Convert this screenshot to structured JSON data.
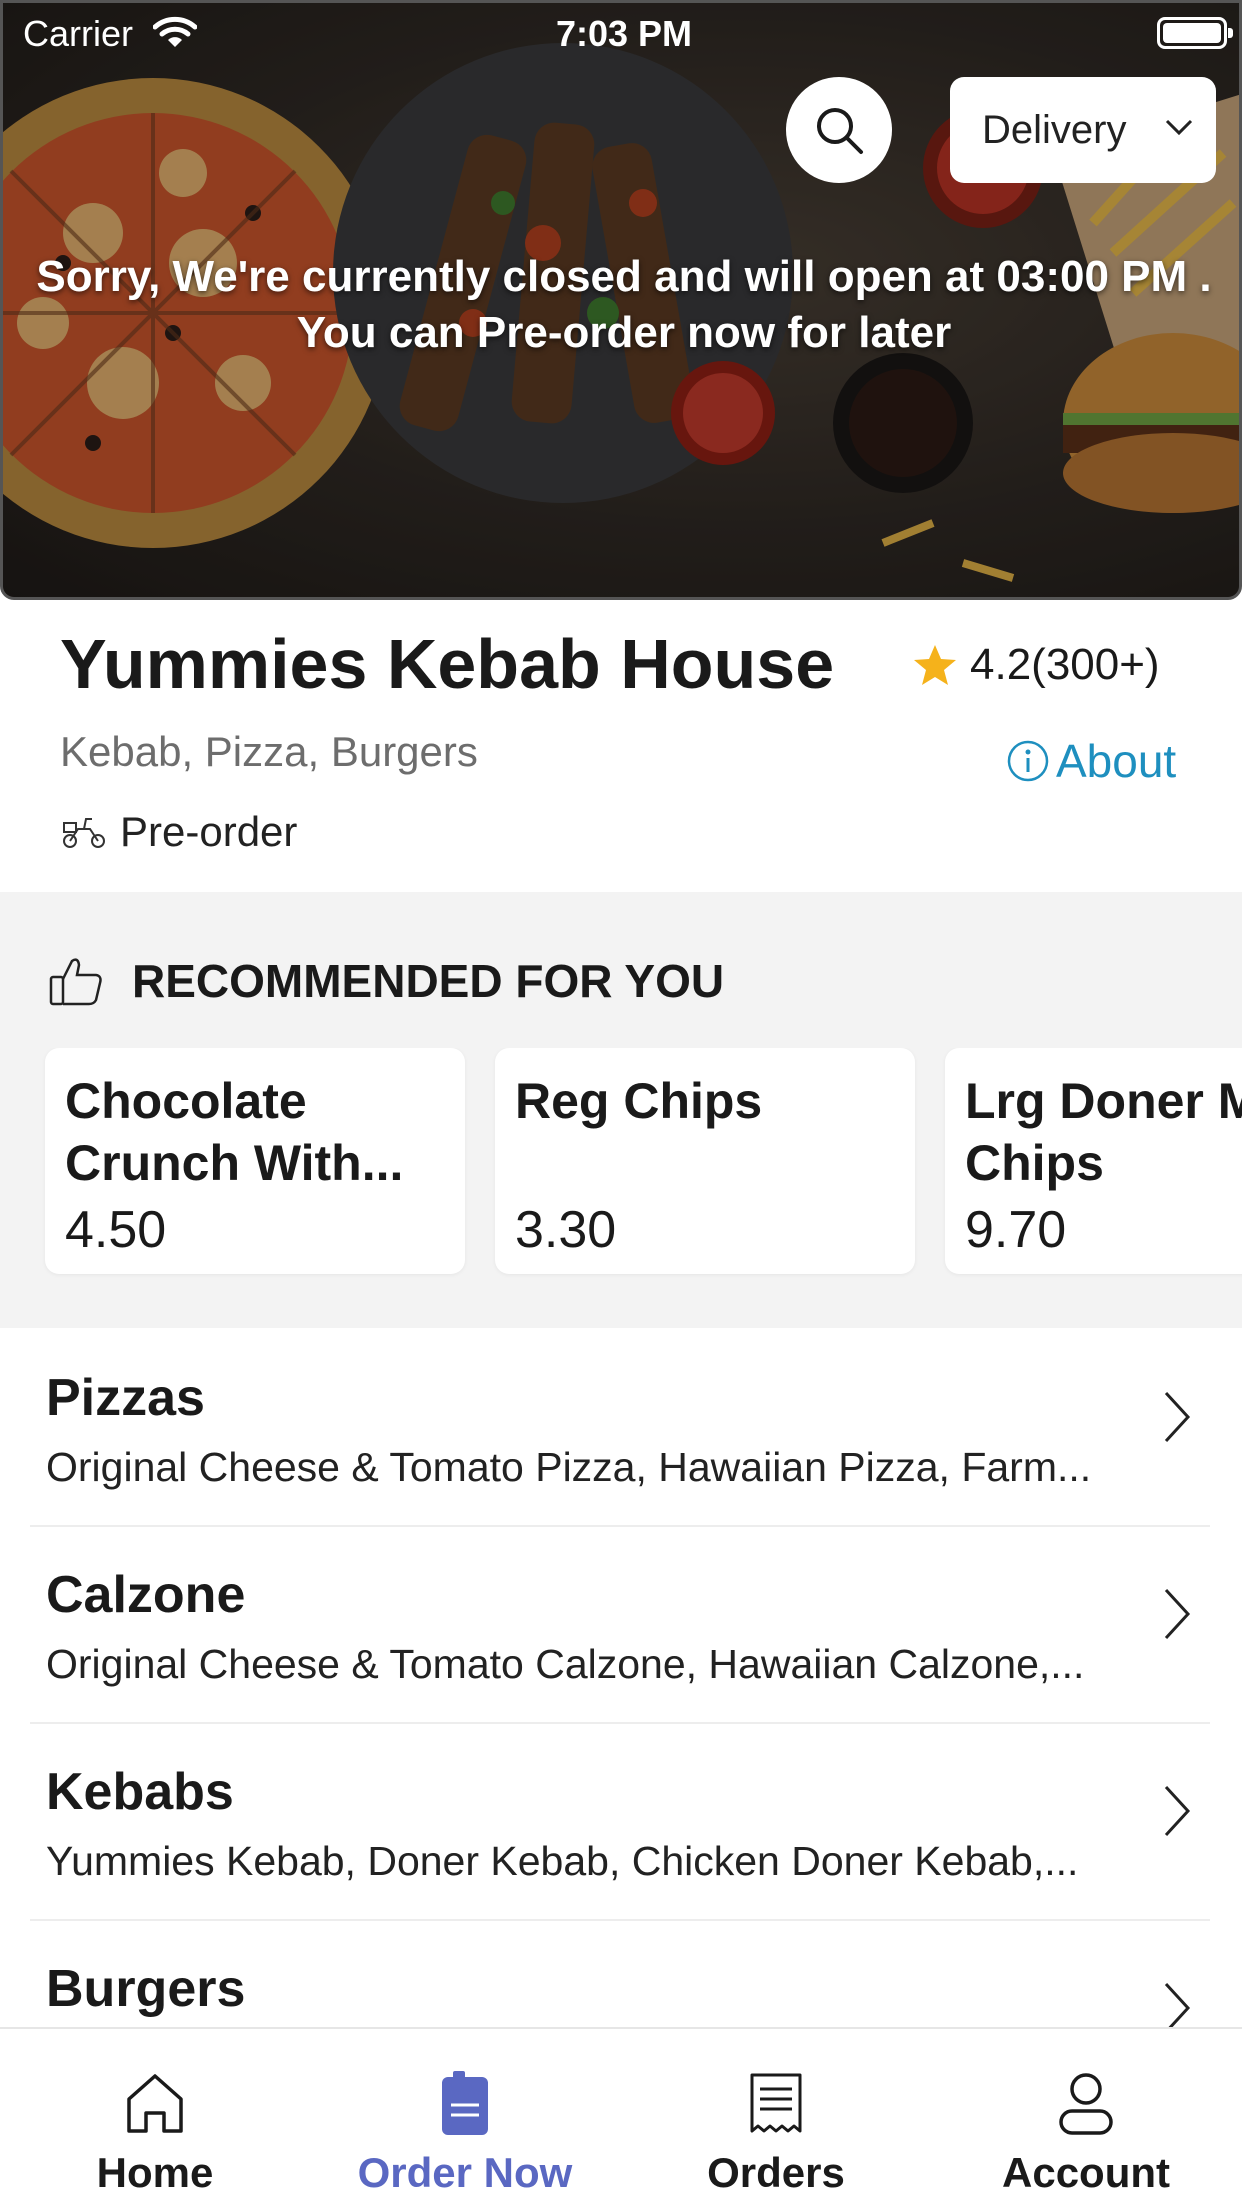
{
  "status_bar": {
    "carrier": "Carrier",
    "time": "7:03 PM"
  },
  "hero": {
    "search_icon": "search-icon",
    "delivery_label": "Delivery",
    "closed_line1": "Sorry, We're currently closed and will open at 03:00 PM .",
    "closed_line2": "You can Pre-order now for later"
  },
  "restaurant": {
    "name": "Yummies Kebab House",
    "rating": "4.2(300+)",
    "cuisines": "Kebab, Pizza, Burgers",
    "about_label": "About",
    "preorder_label": "Pre-order"
  },
  "recommended": {
    "title": "RECOMMENDED FOR YOU",
    "items": [
      {
        "name": "Chocolate Crunch With...",
        "price": "4.50"
      },
      {
        "name": "Reg Chips",
        "price": "3.30"
      },
      {
        "name": "Lrg Doner M & Chips",
        "price": "9.70"
      }
    ]
  },
  "categories": [
    {
      "name": "Pizzas",
      "items": "Original Cheese & Tomato Pizza, Hawaiian Pizza, Farm..."
    },
    {
      "name": "Calzone",
      "items": "Original Cheese & Tomato Calzone, Hawaiian Calzone,..."
    },
    {
      "name": "Kebabs",
      "items": "Yummies Kebab, Doner Kebab, Chicken Doner Kebab,..."
    },
    {
      "name": "Burgers",
      "items": ""
    }
  ],
  "tabbar": {
    "home": "Home",
    "order_now": "Order Now",
    "orders": "Orders",
    "account": "Account"
  },
  "colors": {
    "accent": "#5a68c2",
    "link": "#1e8fbf",
    "star": "#f5b21b",
    "section_bg": "#f3f3f3"
  }
}
